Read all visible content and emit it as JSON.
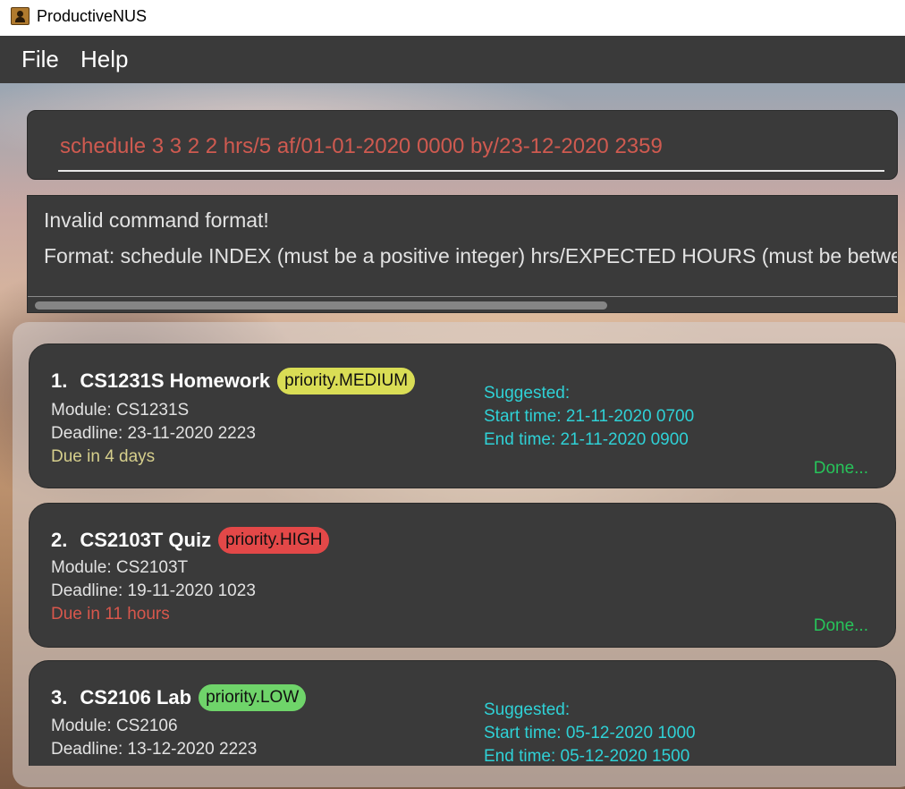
{
  "window": {
    "title": "ProductiveNUS"
  },
  "menu": {
    "file": "File",
    "help": "Help"
  },
  "command": {
    "value": "schedule 3 3 2 2 hrs/5 af/01-01-2020 0000 by/23-12-2020 2359"
  },
  "result": {
    "line1": "Invalid command format!",
    "line2": "Format: schedule INDEX (must be a positive integer) hrs/EXPECTED HOURS (must be betwe"
  },
  "tasks": [
    {
      "index": "1.",
      "name": "CS1231S Homework",
      "priority": "priority.MEDIUM",
      "priority_color": "#d9dd55",
      "module": "Module: CS1231S",
      "deadline": "Deadline: 23-11-2020 2223",
      "due": "Due in 4 days",
      "due_color": "#d6cf8c",
      "suggested_label": "Suggested:",
      "start": "Start time: 21-11-2020 0700",
      "end": "End time: 21-11-2020 0900",
      "done": "Done..."
    },
    {
      "index": "2.",
      "name": "CS2103T Quiz",
      "priority": "priority.HIGH",
      "priority_color": "#e34848",
      "module": "Module: CS2103T",
      "deadline": "Deadline: 19-11-2020 1023",
      "due": "Due in 11 hours",
      "due_color": "#d8574c",
      "done": "Done..."
    },
    {
      "index": "3.",
      "name": "CS2106 Lab",
      "priority": "priority.LOW",
      "priority_color": "#6fd46a",
      "module": "Module: CS2106",
      "deadline": "Deadline: 13-12-2020 2223",
      "suggested_label": "Suggested:",
      "start": "Start time: 05-12-2020 1000",
      "end": "End time: 05-12-2020 1500"
    }
  ]
}
